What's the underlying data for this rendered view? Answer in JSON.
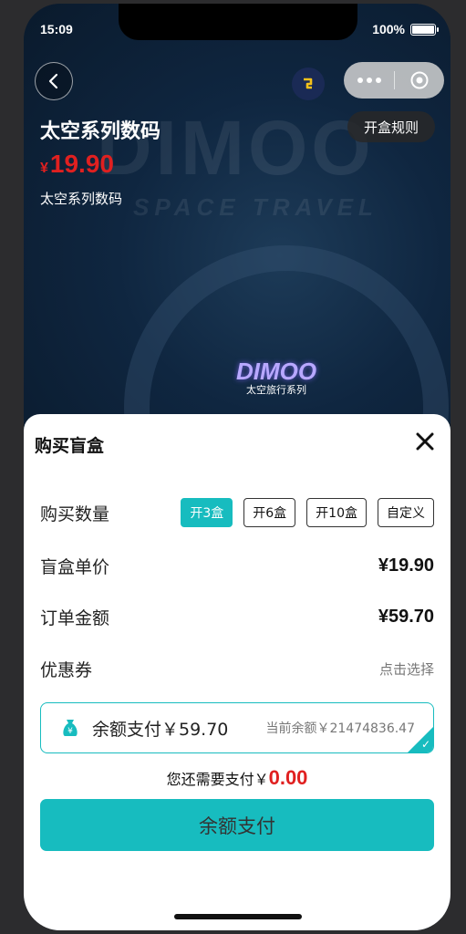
{
  "status": {
    "time": "15:09",
    "battery": "100%"
  },
  "header": {
    "title": "太空系列数码",
    "rules_label": "开盒规则",
    "price_currency": "¥",
    "price_value": "19.90",
    "subtitle": "太空系列数码",
    "watermark_word": "DIMOO",
    "watermark_sub": "SPACE TRAVEL",
    "logo_word": "DIMOO",
    "logo_sub": "太空旅行系列"
  },
  "sheet": {
    "title": "购买盲盒",
    "quantity_label": "购买数量",
    "quantity_options": [
      "开3盒",
      "开6盒",
      "开10盒",
      "自定义"
    ],
    "selected_quantity": "开3盒",
    "unit_price_label": "盲盒单价",
    "unit_price_value": "¥19.90",
    "order_total_label": "订单金额",
    "order_total_value": "¥59.70",
    "coupon_label": "优惠券",
    "coupon_hint": "点击选择",
    "balance_pay_label": "余额支付￥59.70",
    "current_balance": "当前余额￥21474836.47",
    "need_pay_label": "您还需要支付￥",
    "need_pay_value": "0.00",
    "pay_button": "余额支付"
  },
  "colors": {
    "accent": "#17bcbf",
    "price_red": "#e02020"
  }
}
